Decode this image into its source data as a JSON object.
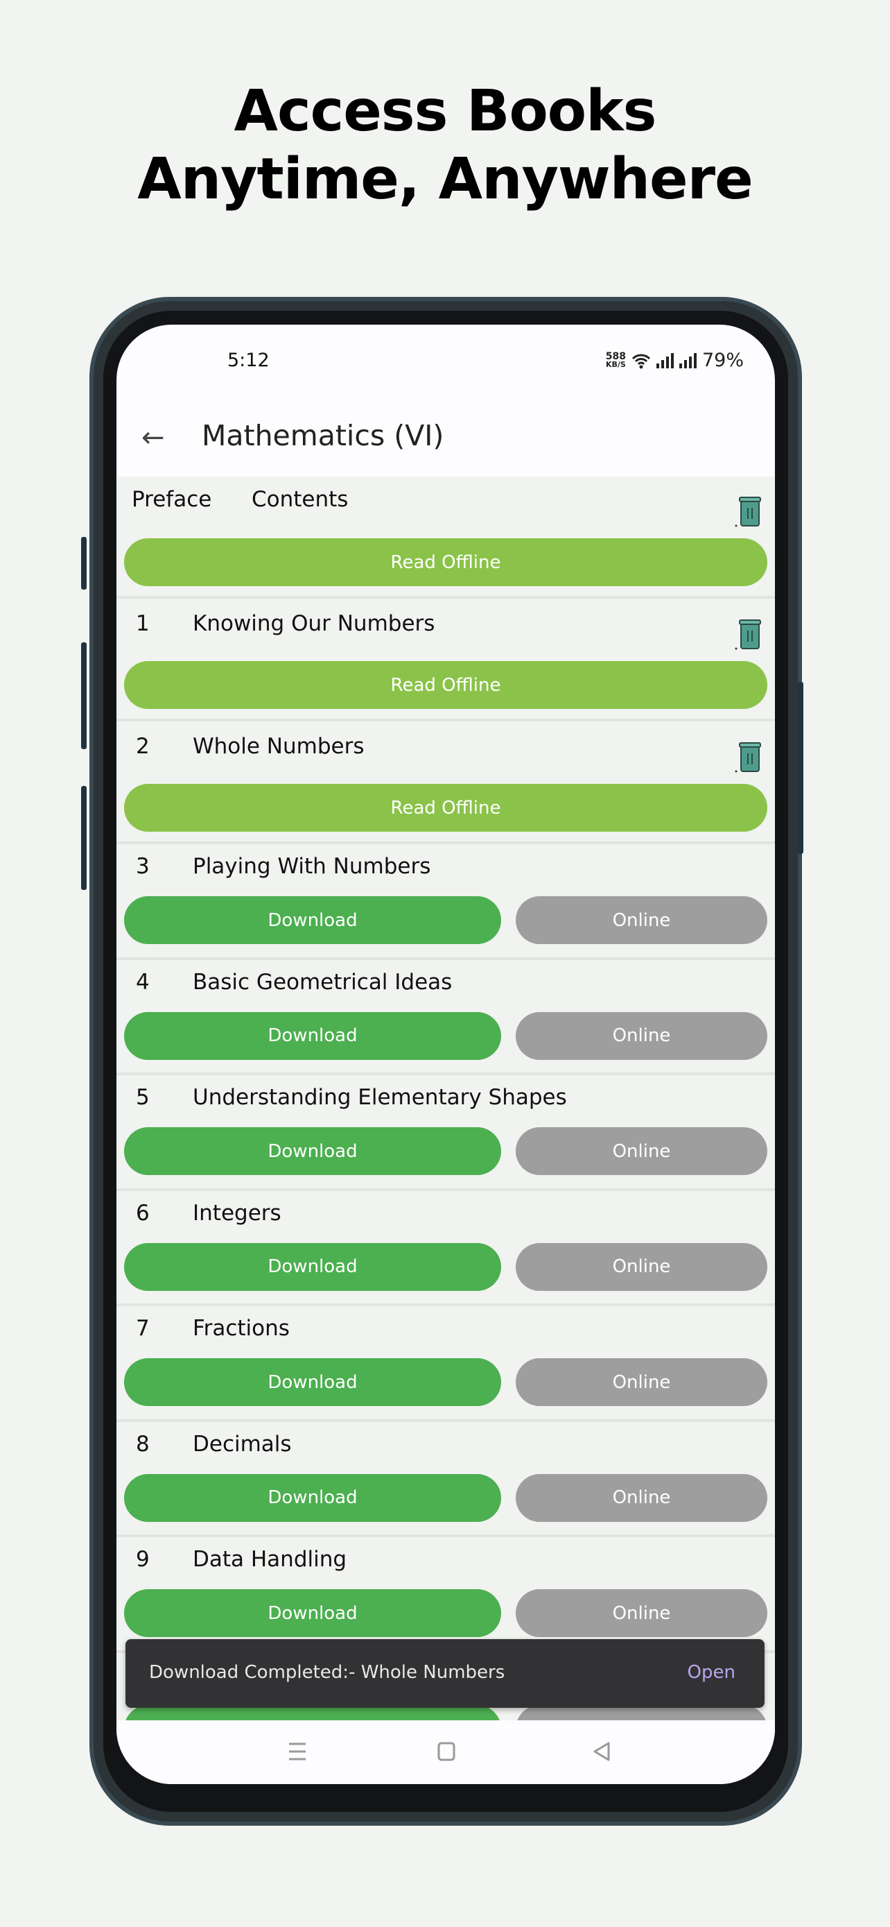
{
  "headline": {
    "line1": "Access Books",
    "line2": "Anytime, Anywhere"
  },
  "status": {
    "time": "5:12",
    "speed_value": "588",
    "speed_unit": "KB/S",
    "battery": "79%"
  },
  "appbar": {
    "title": "Mathematics (VI)",
    "back_icon": "arrow-left-icon"
  },
  "front": {
    "preface": "Preface",
    "contents": "Contents",
    "button": "Read Offline"
  },
  "chapters": [
    {
      "num": "1",
      "name": "Knowing Our Numbers",
      "state": "offline",
      "button": "Read Offline"
    },
    {
      "num": "2",
      "name": "Whole Numbers",
      "state": "offline",
      "button": "Read Offline"
    },
    {
      "num": "3",
      "name": "Playing With Numbers",
      "state": "online",
      "download": "Download",
      "online": "Online"
    },
    {
      "num": "4",
      "name": "Basic Geometrical Ideas",
      "state": "online",
      "download": "Download",
      "online": "Online"
    },
    {
      "num": "5",
      "name": "Understanding Elementary Shapes",
      "state": "online",
      "download": "Download",
      "online": "Online"
    },
    {
      "num": "6",
      "name": "Integers",
      "state": "online",
      "download": "Download",
      "online": "Online"
    },
    {
      "num": "7",
      "name": "Fractions",
      "state": "online",
      "download": "Download",
      "online": "Online"
    },
    {
      "num": "8",
      "name": "Decimals",
      "state": "online",
      "download": "Download",
      "online": "Online"
    },
    {
      "num": "9",
      "name": "Data Handling",
      "state": "online",
      "download": "Download",
      "online": "Online"
    }
  ],
  "snackbar": {
    "message": "Download Completed:- Whole Numbers",
    "action": "Open"
  },
  "colors": {
    "read_offline": "#8bc34a",
    "download": "#4caf50",
    "online": "#9e9e9e",
    "snack_action": "#b9a6ec"
  }
}
